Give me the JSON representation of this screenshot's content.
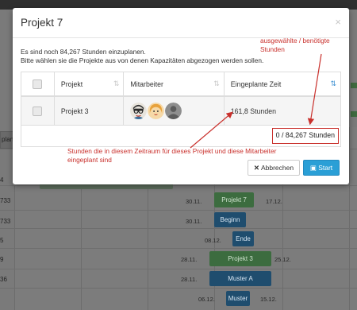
{
  "modal": {
    "title": "Projekt 7",
    "intro_line1": "Es sind noch 84,267 Stunden einzuplanen.",
    "intro_line2": "Bitte wählen sie die Projekte aus von denen Kapazitäten abgezogen werden sollen.",
    "table": {
      "headers": [
        "Projekt",
        "Mitarbeiter",
        "Eingeplante Zeit"
      ],
      "rows": [
        {
          "project": "Projekt 3",
          "time": "161,8 Stunden",
          "avatars": [
            "nerd-avatar-icon",
            "woman-avatar-icon",
            "person-placeholder-icon"
          ]
        }
      ],
      "total": "0 / 84,267 Stunden"
    },
    "cancel_label": "Abbrechen",
    "start_label": "Start"
  },
  "annotations": {
    "top_right_line1": "ausgewählte / benötigte",
    "top_right_line2": "Stunden",
    "bottom_line1": "Stunden die in diesem Zeitraum für dieses Projekt und diese Mitarbeiter",
    "bottom_line2": "eingeplant sind"
  },
  "background": {
    "left_tab": "plant",
    "rows": [
      "4",
      "733",
      "733",
      "5",
      "9",
      "36"
    ],
    "dates": [
      "30.11.",
      "17.12.",
      "30.11.",
      "08.12.",
      "28.11.",
      "25.12.",
      "28.11.",
      "06.12.",
      "15.12."
    ],
    "bars": [
      "Projekt 7",
      "Beginn",
      "Ende",
      "Projekt 3",
      "Muster A",
      "Muster"
    ]
  },
  "colors": {
    "accent": "#2a9fd6",
    "annotation": "#c9302c",
    "sort_active": "#3b8fd1"
  }
}
